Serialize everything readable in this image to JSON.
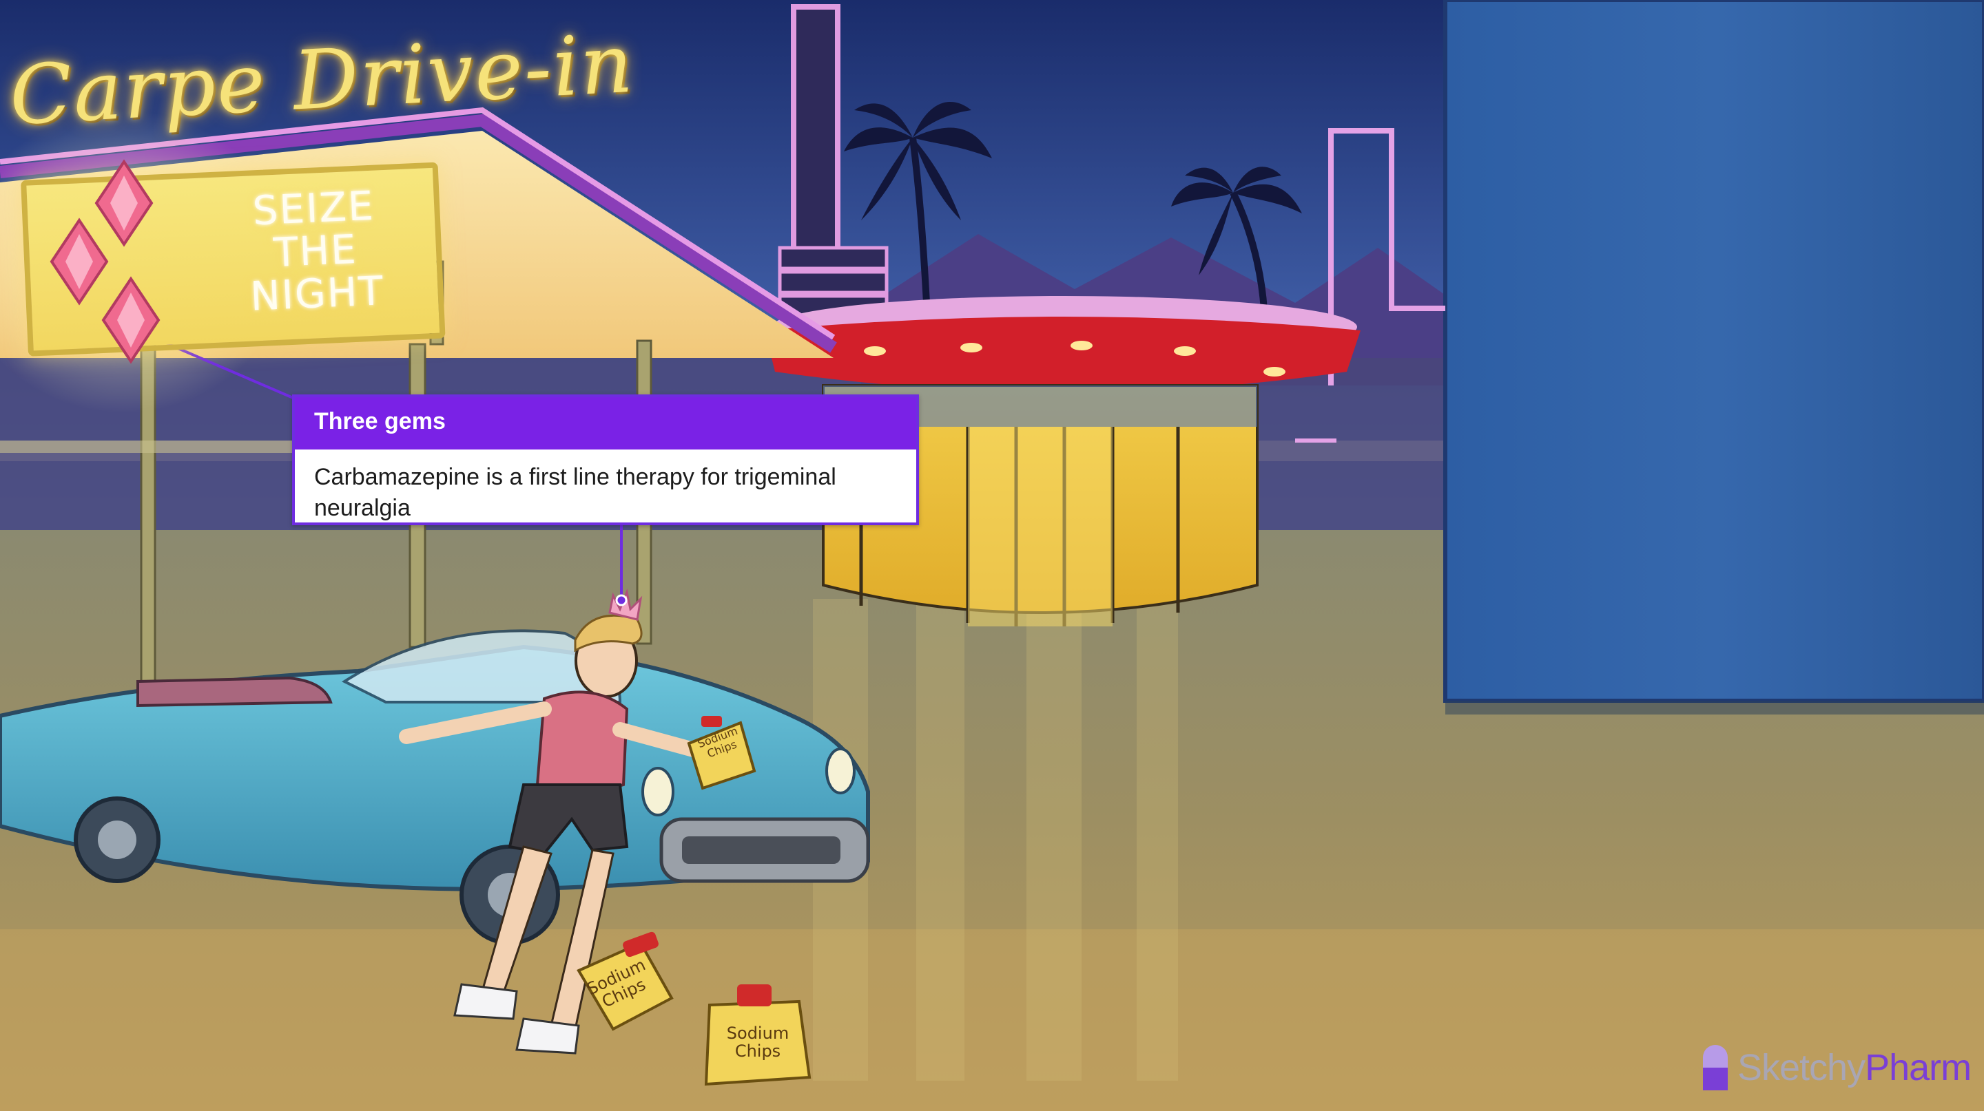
{
  "scene": {
    "sign_title": "Carpe Drive-in",
    "sign_slogan": "SEIZE THE NIGHT"
  },
  "callout": {
    "title": "Three gems",
    "body": "Carbamazepine is a first line therapy for trigeminal neuralgia",
    "accent_color": "#7a22e6"
  },
  "props": {
    "chips_label": "Sodium Chips"
  },
  "brand": {
    "name_part1": "Sketchy",
    "name_part2": "Pharm",
    "icon": "pill-icon",
    "color_primary": "#7a3fd6",
    "color_secondary": "#a9a6b4"
  }
}
